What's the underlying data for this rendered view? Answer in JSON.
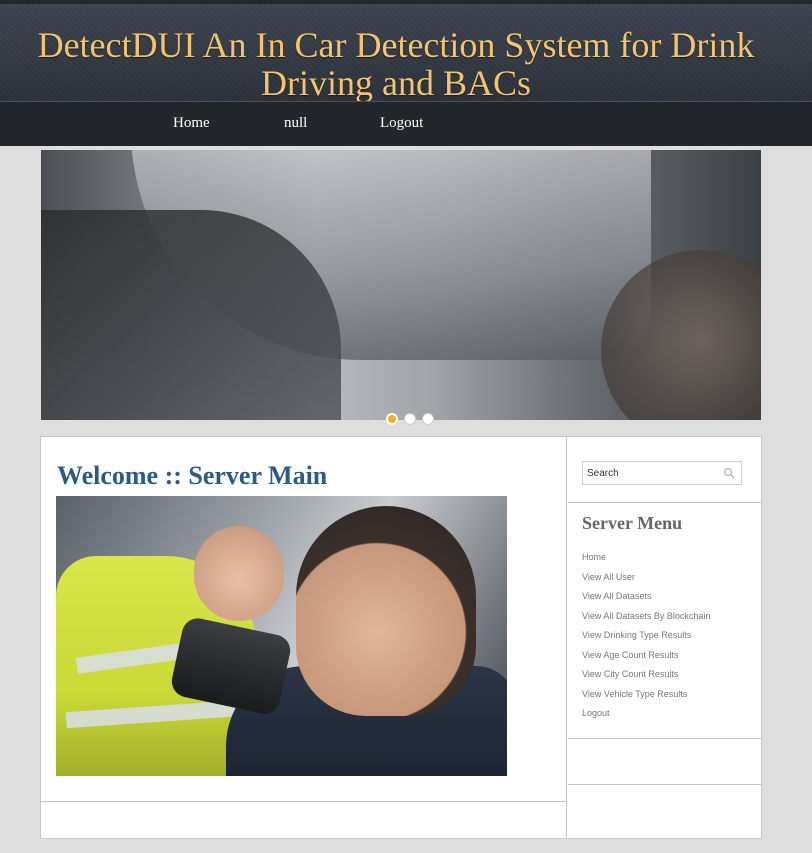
{
  "header": {
    "title": "DetectDUI An In Car Detection System for Drink Driving and BACs"
  },
  "nav": {
    "items": [
      {
        "label": "Home"
      },
      {
        "label": "null"
      },
      {
        "label": "Logout"
      }
    ]
  },
  "slider": {
    "image_alt": "breathalyzer-in-car",
    "active_index": 0,
    "dot_count": 3,
    "active_color": "#f0b321"
  },
  "main": {
    "title": "Welcome :: Server Main",
    "photo_alt": "driver-breath-test"
  },
  "sidebar": {
    "search": {
      "placeholder": "Search"
    },
    "menu_title": "Server Menu",
    "menu": [
      "Home",
      "View All User",
      "View All Datasets",
      "View All Datasets By Blockchain",
      "View Drinking Type Results",
      "View Age Count Results",
      "View City Count Results",
      "View Vehicle Type Results",
      "Logout"
    ]
  },
  "colors": {
    "title_gold": "#f2c46b",
    "nav_bg": "#23272c",
    "page_title_blue": "#2a5a8b"
  }
}
